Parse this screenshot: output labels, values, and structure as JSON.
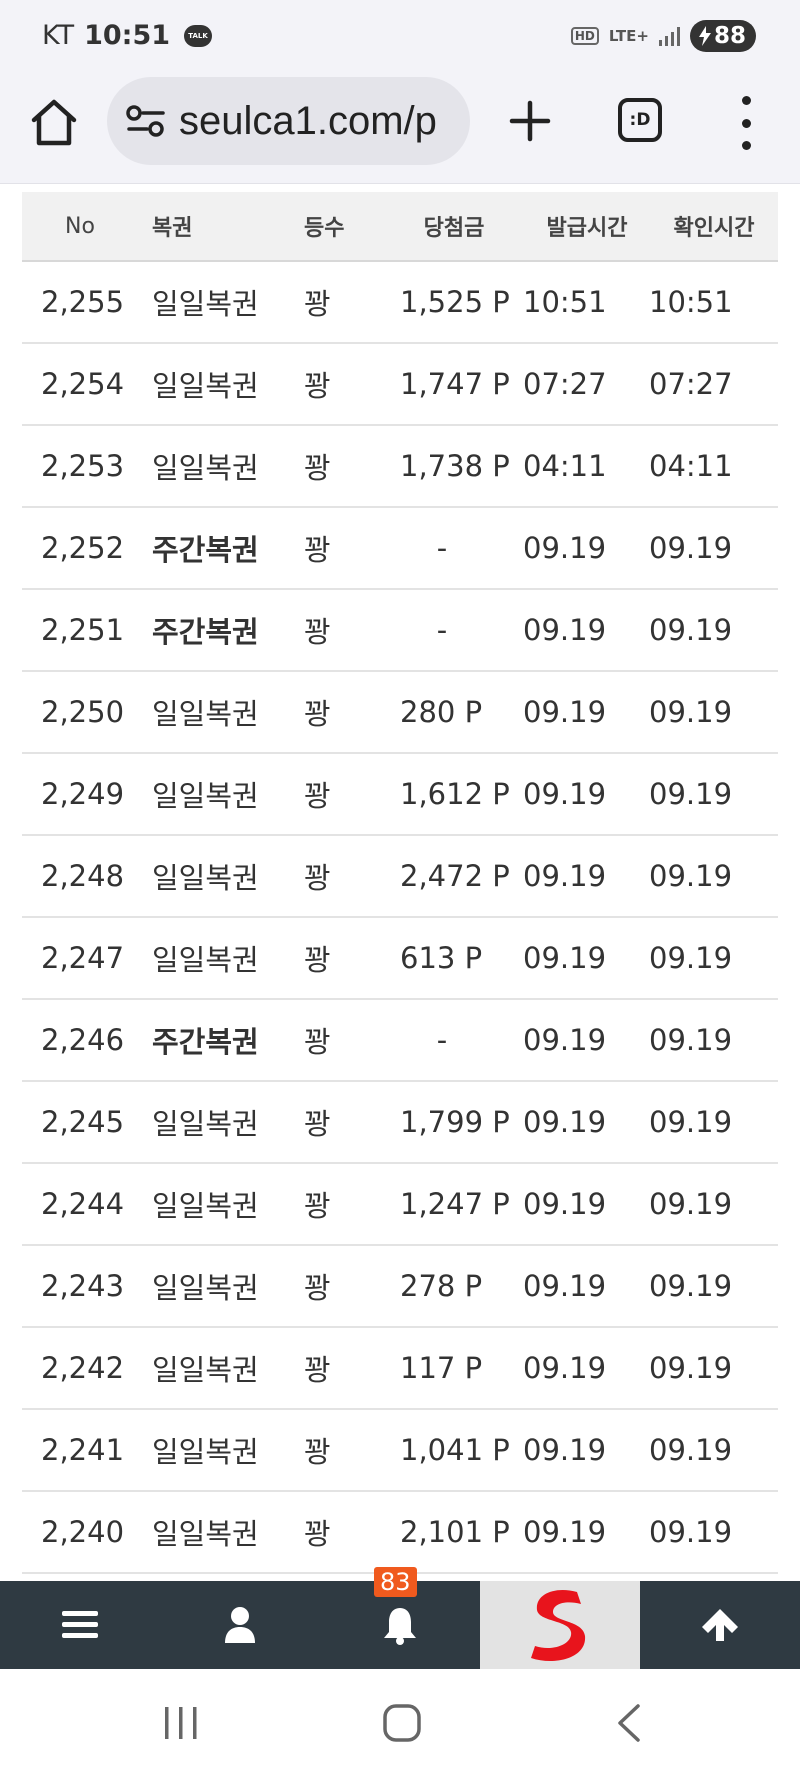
{
  "status_bar": {
    "carrier": "KT",
    "time": "10:51",
    "talk_label": "TALK",
    "hd_label": "HD",
    "lte_label": "LTE+",
    "battery": "88"
  },
  "browser": {
    "url": "seulca1.com/p",
    "tabs_label": ":D"
  },
  "table": {
    "headers": {
      "no": "No",
      "type": "복권",
      "rank": "등수",
      "prize": "당첨금",
      "issue_time": "발급시간",
      "check_time": "확인시간"
    },
    "rows": [
      {
        "no": "2,255",
        "type": "일일복권",
        "rank": "꽝",
        "prize": "1,525 P",
        "issue": "10:51",
        "check": "10:51"
      },
      {
        "no": "2,254",
        "type": "일일복권",
        "rank": "꽝",
        "prize": "1,747 P",
        "issue": "07:27",
        "check": "07:27"
      },
      {
        "no": "2,253",
        "type": "일일복권",
        "rank": "꽝",
        "prize": "1,738 P",
        "issue": "04:11",
        "check": "04:11"
      },
      {
        "no": "2,252",
        "type": "주간복권",
        "rank": "꽝",
        "prize": "-",
        "issue": "09.19",
        "check": "09.19"
      },
      {
        "no": "2,251",
        "type": "주간복권",
        "rank": "꽝",
        "prize": "-",
        "issue": "09.19",
        "check": "09.19"
      },
      {
        "no": "2,250",
        "type": "일일복권",
        "rank": "꽝",
        "prize": "280 P",
        "issue": "09.19",
        "check": "09.19"
      },
      {
        "no": "2,249",
        "type": "일일복권",
        "rank": "꽝",
        "prize": "1,612 P",
        "issue": "09.19",
        "check": "09.19"
      },
      {
        "no": "2,248",
        "type": "일일복권",
        "rank": "꽝",
        "prize": "2,472 P",
        "issue": "09.19",
        "check": "09.19"
      },
      {
        "no": "2,247",
        "type": "일일복권",
        "rank": "꽝",
        "prize": "613 P",
        "issue": "09.19",
        "check": "09.19"
      },
      {
        "no": "2,246",
        "type": "주간복권",
        "rank": "꽝",
        "prize": "-",
        "issue": "09.19",
        "check": "09.19"
      },
      {
        "no": "2,245",
        "type": "일일복권",
        "rank": "꽝",
        "prize": "1,799 P",
        "issue": "09.19",
        "check": "09.19"
      },
      {
        "no": "2,244",
        "type": "일일복권",
        "rank": "꽝",
        "prize": "1,247 P",
        "issue": "09.19",
        "check": "09.19"
      },
      {
        "no": "2,243",
        "type": "일일복권",
        "rank": "꽝",
        "prize": "278 P",
        "issue": "09.19",
        "check": "09.19"
      },
      {
        "no": "2,242",
        "type": "일일복권",
        "rank": "꽝",
        "prize": "117 P",
        "issue": "09.19",
        "check": "09.19"
      },
      {
        "no": "2,241",
        "type": "일일복권",
        "rank": "꽝",
        "prize": "1,041 P",
        "issue": "09.19",
        "check": "09.19"
      },
      {
        "no": "2,240",
        "type": "일일복권",
        "rank": "꽝",
        "prize": "2,101 P",
        "issue": "09.19",
        "check": "09.19"
      }
    ]
  },
  "bottom_nav": {
    "items": [
      "menu-icon",
      "user-icon",
      "bell-icon",
      "site-logo-icon",
      "arrow-up-icon"
    ],
    "notification_count": "83",
    "bar_color": "#2f3a42",
    "badge_color": "#f05a1e",
    "logo_color": "#e8141c"
  },
  "system_nav": {
    "items": [
      "recents-icon",
      "home-icon",
      "back-icon"
    ]
  }
}
